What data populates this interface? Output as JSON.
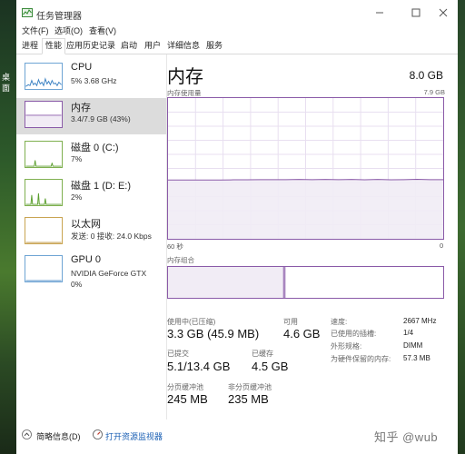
{
  "window": {
    "title": "任务管理器"
  },
  "desktop": {
    "left_text": [
      "桌",
      "面"
    ]
  },
  "menu": [
    "文件(F)",
    "选项(O)",
    "查看(V)"
  ],
  "tabs": [
    "进程",
    "性能",
    "应用历史记录",
    "启动",
    "用户",
    "详细信息",
    "服务"
  ],
  "active_tab": "性能",
  "sidebar": {
    "items": [
      {
        "title": "CPU",
        "sub": "5%  3.68 GHz"
      },
      {
        "title": "内存",
        "sub": "3.4/7.9 GB (43%)"
      },
      {
        "title": "磁盘 0 (C:)",
        "sub": "7%"
      },
      {
        "title": "磁盘 1 (D: E:)",
        "sub": "2%"
      },
      {
        "title": "以太网",
        "sub": "发送: 0  接收: 24.0 Kbps"
      },
      {
        "title": "GPU 0",
        "sub": "NVIDIA GeForce GTX",
        "sub2": "0%"
      }
    ],
    "selected": "内存"
  },
  "main": {
    "title": "内存",
    "total": "8.0 GB",
    "usage_caption": "内存使用量",
    "usage_max": "7.9 GB",
    "x_left": "60 秒",
    "x_right": "0",
    "composition_caption": "内存组合",
    "composition": {
      "in_use_fraction": 0.42,
      "modified_fraction": 0.005
    }
  },
  "chart_data": {
    "type": "area",
    "title": "内存使用量",
    "xlabel": "",
    "ylabel": "",
    "x_range_seconds": [
      60,
      0
    ],
    "ylim": [
      0,
      7.9
    ],
    "unit": "GB",
    "grid": true,
    "series": [
      {
        "values": [
          3.3,
          3.3,
          3.3,
          3.3,
          3.3,
          3.31,
          3.31,
          3.32,
          3.32,
          3.32,
          3.33,
          3.32,
          3.33,
          3.32,
          3.33,
          3.31,
          3.33,
          3.31,
          3.32,
          3.34,
          3.32,
          3.32
        ]
      }
    ]
  },
  "stats": {
    "in_use_label": "使用中(已压缩)",
    "in_use_value": "3.3 GB (45.9 MB)",
    "available_label": "可用",
    "available_value": "4.6 GB",
    "committed_label": "已提交",
    "committed_value": "5.1/13.4 GB",
    "cached_label": "已缓存",
    "cached_value": "4.5 GB",
    "paged_label": "分页缓冲池",
    "paged_value": "245 MB",
    "nonpaged_label": "非分页缓冲池",
    "nonpaged_value": "235 MB"
  },
  "specs": [
    {
      "label": "速度:",
      "value": "2667 MHz"
    },
    {
      "label": "已使用的插槽:",
      "value": "1/4"
    },
    {
      "label": "外形规格:",
      "value": "DIMM"
    },
    {
      "label": "为硬件保留的内存:",
      "value": "57.3 MB"
    }
  ],
  "footer": {
    "less_details": "简略信息(D)",
    "open_monitor": "打开资源监视器"
  },
  "watermark": "知乎 @wub",
  "colors": {
    "memory_accent": "#8a5aa8",
    "memory_fill": "#f1ecf5",
    "cpu_accent": "#3c82c3",
    "disk_accent": "#5b9e2e",
    "ethernet_accent": "#b88a2a",
    "gpu_accent": "#3c82c3"
  }
}
